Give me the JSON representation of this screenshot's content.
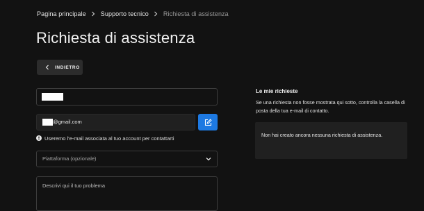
{
  "breadcrumb": {
    "items": [
      "Pagina principale",
      "Supporto tecnico",
      "Richiesta di assistenza"
    ],
    "separator_icon": "chevron-right-icon"
  },
  "page": {
    "title": "Richiesta di assistenza"
  },
  "back_button": {
    "label": "INDIETRO",
    "icon": "chevron-left-icon"
  },
  "form": {
    "email": {
      "value": "@gmail.com"
    },
    "edit_email_icon": "edit-icon",
    "email_note": "Useremo l'e-mail associata al tuo account per contattarti",
    "platform": {
      "value": "Piattaforma (opzionale)"
    },
    "problem": {
      "placeholder": "Descrivi qui il tuo problema"
    }
  },
  "my_requests": {
    "title": "Le mie richieste",
    "description": "Se una richiesta non fosse mostrata qui sotto, controlla la casella di posta della tua e-mail di contatto.",
    "empty_message": "Non hai creato ancora nessuna richiesta di assistenza."
  },
  "colors": {
    "background": "#121212",
    "accent": "#1d79e2",
    "panel": "#202020",
    "border": "#3c3c3c"
  }
}
